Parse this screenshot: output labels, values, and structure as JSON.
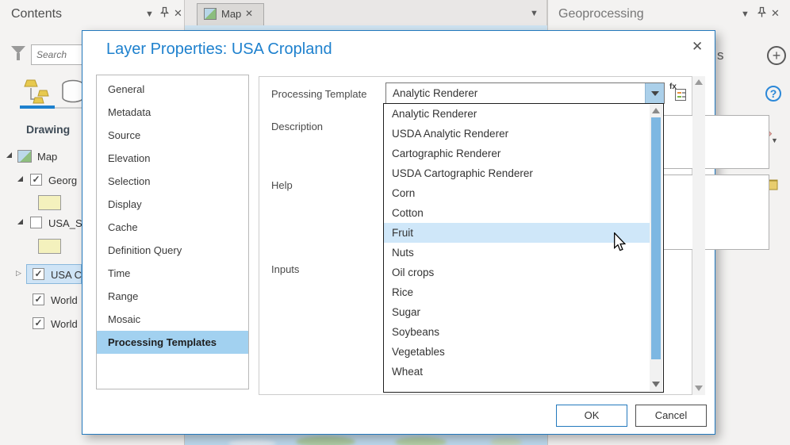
{
  "contents": {
    "title": "Contents",
    "search_placeholder": "Search",
    "heading": "Drawing",
    "tree": {
      "rows": [
        {
          "label": "Map"
        },
        {
          "label": "Georg"
        },
        {
          "label": "USA_S"
        },
        {
          "label": "USA C"
        },
        {
          "label": "World"
        },
        {
          "label": "World"
        }
      ]
    }
  },
  "map_view": {
    "tab_label": "Map"
  },
  "geoprocessing": {
    "title": "Geoprocessing",
    "partial_heading_text": "s",
    "help_glyph": "?",
    "plus_glyph": "+"
  },
  "dialog": {
    "title": "Layer Properties: USA Cropland",
    "close_glyph": "✕",
    "sidebar": {
      "items": [
        "General",
        "Metadata",
        "Source",
        "Elevation",
        "Selection",
        "Display",
        "Cache",
        "Definition Query",
        "Time",
        "Range",
        "Mosaic",
        "Processing Templates"
      ],
      "selected": "Processing Templates"
    },
    "labels": {
      "processing_template": "Processing Template",
      "description": "Description",
      "help": "Help",
      "inputs": "Inputs"
    },
    "combobox": {
      "value": "Analytic Renderer"
    },
    "fx_label": "fx",
    "buttons": {
      "ok": "OK",
      "cancel": "Cancel"
    }
  },
  "dropdown": {
    "items": [
      "Analytic Renderer",
      "USDA Analytic Renderer",
      "Cartographic Renderer",
      "USDA Cartographic Renderer",
      "Corn",
      "Cotton",
      "Fruit",
      "Nuts",
      "Oil crops",
      "Rice",
      "Sugar",
      "Soybeans",
      "Vegetables",
      "Wheat"
    ],
    "highlighted": "Fruit"
  },
  "checkmark_glyph": "✓",
  "colors": {
    "accent_blue": "#1e81ce",
    "dialog_border": "#2479bd",
    "sidebar_selection": "#a2d1f0",
    "dropdown_highlight": "#cfe7f9",
    "scroll_thumb": "#7db7e2",
    "green_plus": "#55a055",
    "folder_gold": "#dcba50"
  }
}
